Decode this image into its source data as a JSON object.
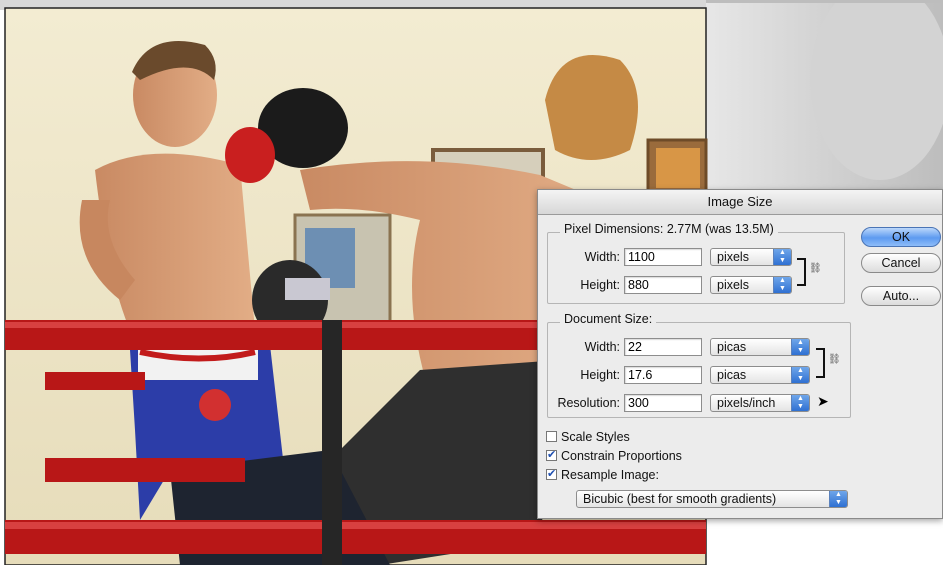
{
  "dialog": {
    "title": "Image Size",
    "pixel_dimensions": {
      "label": "Pixel Dimensions:",
      "value": "2.77M (was 13.5M)",
      "width_label": "Width:",
      "width_value": "1100",
      "width_unit": "pixels",
      "height_label": "Height:",
      "height_value": "880",
      "height_unit": "pixels"
    },
    "document_size": {
      "label": "Document Size:",
      "width_label": "Width:",
      "width_value": "22",
      "width_unit": "picas",
      "height_label": "Height:",
      "height_value": "17.6",
      "height_unit": "picas",
      "resolution_label": "Resolution:",
      "resolution_value": "300",
      "resolution_unit": "pixels/inch"
    },
    "options": {
      "scale_styles": {
        "label": "Scale Styles",
        "checked": false
      },
      "constrain_proportions": {
        "label": "Constrain Proportions",
        "checked": true
      },
      "resample_image": {
        "label": "Resample Image:",
        "checked": true
      }
    },
    "resample_method": "Bicubic (best for smooth gradients)",
    "buttons": {
      "ok": "OK",
      "cancel": "Cancel",
      "auto": "Auto..."
    }
  },
  "icons": [
    "chain-link-icon",
    "popup-arrows-icon",
    "checkmark-icon",
    "mouse-cursor-icon"
  ],
  "colors": {
    "accent": "#3b7ee0",
    "dialog_bg": "#ececec",
    "ring_rope": "#b81717"
  }
}
